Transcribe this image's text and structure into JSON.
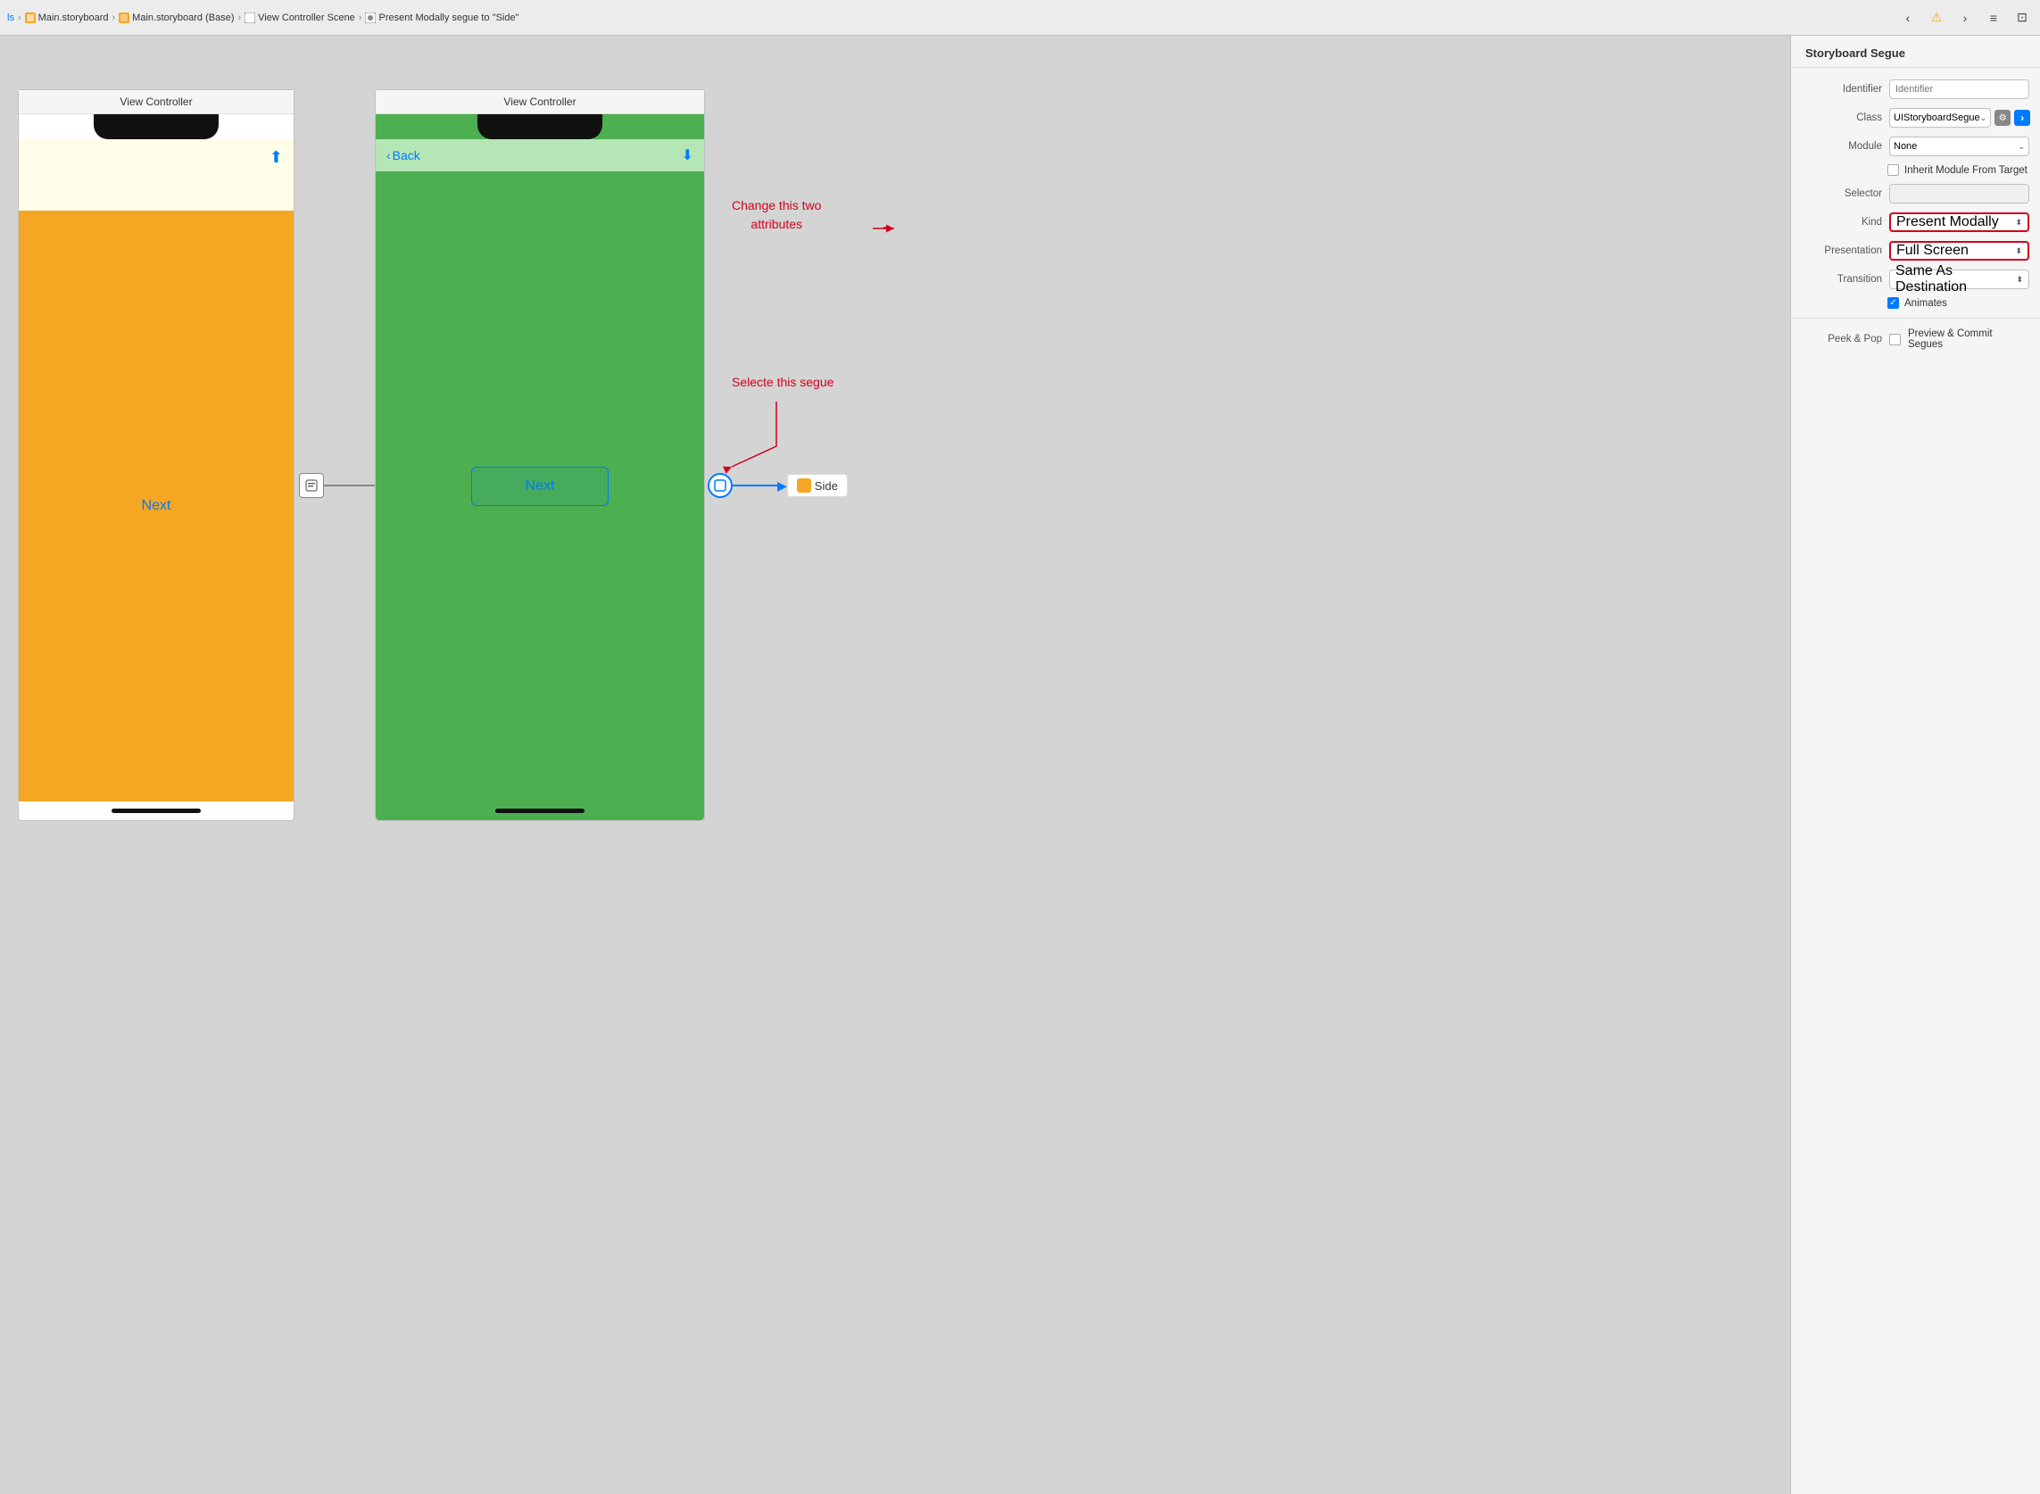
{
  "toolbar": {
    "breadcrumb": [
      {
        "label": "ls",
        "icon": "file-icon"
      },
      {
        "label": "Main.storyboard",
        "icon": "storyboard-icon"
      },
      {
        "label": "Main.storyboard (Base)",
        "icon": "storyboard-base-icon"
      },
      {
        "label": "View Controller Scene",
        "icon": "scene-icon"
      },
      {
        "label": "Present Modally segue to \"Side\"",
        "icon": "segue-icon"
      }
    ],
    "icons": [
      "chevron-left",
      "warning",
      "chevron-right",
      "menu",
      "square"
    ]
  },
  "canvas": {
    "vc_left": {
      "title": "View Controller",
      "next_label": "Next"
    },
    "vc_center": {
      "title": "View Controller",
      "back_label": "Back",
      "next_button": "Next"
    },
    "side_badge": "Side",
    "annotation_change": "Change this two\nattributes",
    "annotation_select": "Selecte this segue"
  },
  "inspector": {
    "title": "Storyboard Segue",
    "rows": [
      {
        "label": "Identifier",
        "type": "input",
        "placeholder": "Identifier",
        "value": ""
      },
      {
        "label": "Class",
        "type": "class-select",
        "value": "UIStoryboardSegue"
      },
      {
        "label": "Module",
        "type": "module-select",
        "value": "None"
      },
      {
        "label": "",
        "type": "checkbox-inherit",
        "value": "Inherit Module From Target",
        "checked": false
      },
      {
        "label": "Selector",
        "type": "input-empty",
        "value": ""
      },
      {
        "label": "Kind",
        "type": "select-red",
        "value": "Present Modally"
      },
      {
        "label": "Presentation",
        "type": "select-red",
        "value": "Full Screen"
      },
      {
        "label": "Transition",
        "type": "select",
        "value": "Same As Destination"
      }
    ],
    "animates": {
      "label": "Animates",
      "checked": true
    },
    "peek_pop": {
      "label": "Peek & Pop",
      "checkbox_checked": false,
      "value": "Preview & Commit Segues"
    }
  }
}
